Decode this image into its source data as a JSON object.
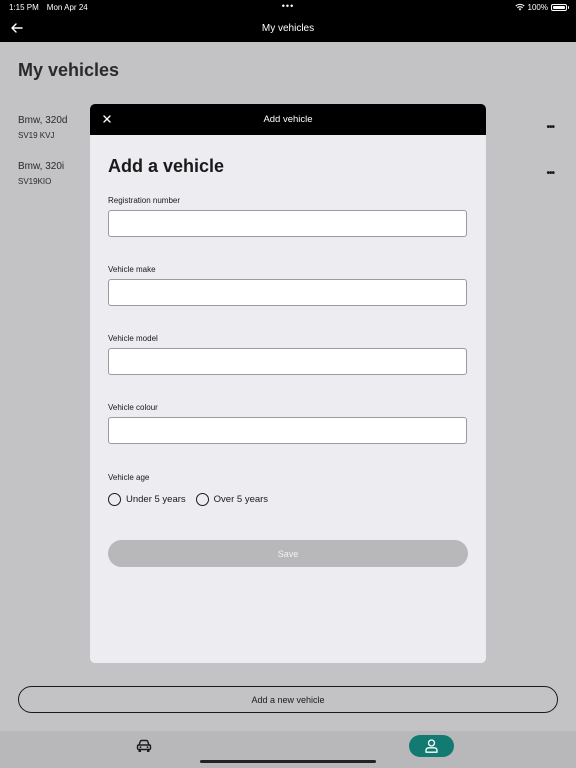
{
  "status_bar": {
    "time": "1:15 PM",
    "date": "Mon Apr 24",
    "center_dots": "•••",
    "battery_text": "100%"
  },
  "nav": {
    "title": "My vehicles",
    "back_icon": "arrow-left-icon"
  },
  "page": {
    "title": "My vehicles",
    "vehicles": [
      {
        "name": "Bmw, 320d",
        "registration": "SV19 KVJ",
        "menu": "•••"
      },
      {
        "name": "Bmw, 320i",
        "registration": "SV19KIO",
        "menu": "•••"
      }
    ],
    "add_new_label": "Add a new vehicle"
  },
  "tab_bar": {
    "items": [
      {
        "icon": "car-icon",
        "active": false
      },
      {
        "icon": "person-icon",
        "active": true
      }
    ],
    "active_color": "#137a72"
  },
  "modal": {
    "title": "Add vehicle",
    "close_icon": "close-icon",
    "heading": "Add a vehicle",
    "fields": [
      {
        "label": "Registration number",
        "value": "",
        "placeholder": ""
      },
      {
        "label": "Vehicle make",
        "value": "",
        "placeholder": ""
      },
      {
        "label": "Vehicle model",
        "value": "",
        "placeholder": ""
      },
      {
        "label": "Vehicle colour",
        "value": "",
        "placeholder": ""
      }
    ],
    "age": {
      "label": "Vehicle age",
      "options": [
        {
          "label": "Under 5 years",
          "selected": false
        },
        {
          "label": "Over 5 years",
          "selected": false
        }
      ]
    },
    "save_label": "Save"
  }
}
